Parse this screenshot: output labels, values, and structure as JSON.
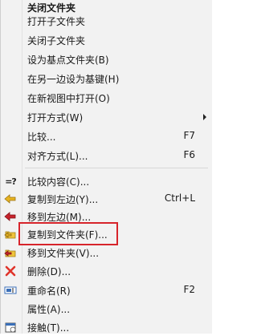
{
  "menu": {
    "items": [
      {
        "label": "关闭文件夹",
        "shortcut": "",
        "submenu": false,
        "bold": true,
        "icon": ""
      },
      {
        "label": "打开子文件夹",
        "shortcut": "",
        "submenu": false,
        "icon": ""
      },
      {
        "label": "关闭子文件夹",
        "shortcut": "",
        "submenu": false,
        "icon": ""
      },
      {
        "label": "设为基点文件夹(B)",
        "shortcut": "",
        "submenu": false,
        "icon": ""
      },
      {
        "label": "在另一边设为基键(H)",
        "shortcut": "",
        "submenu": false,
        "icon": ""
      },
      {
        "label": "在新视图中打开(O)",
        "shortcut": "",
        "submenu": false,
        "icon": ""
      },
      {
        "label": "打开方式(W)",
        "shortcut": "",
        "submenu": true,
        "icon": ""
      },
      {
        "label": "比较...",
        "shortcut": "F7",
        "submenu": false,
        "icon": ""
      },
      {
        "label": "对齐方式(L)...",
        "shortcut": "F6",
        "submenu": false,
        "icon": ""
      },
      {
        "label": "比较内容(C)...",
        "shortcut": "",
        "submenu": false,
        "icon": "equals-question-icon",
        "icon_text": "=?"
      },
      {
        "label": "复制到左边(Y)...",
        "shortcut": "Ctrl+L",
        "submenu": false,
        "icon": "copy-left-arrow-icon"
      },
      {
        "label": "移到左边(M)...",
        "shortcut": "",
        "submenu": false,
        "icon": "move-left-arrow-icon"
      },
      {
        "label": "复制到文件夹(F)...",
        "shortcut": "",
        "submenu": false,
        "icon": "copy-to-folder-icon"
      },
      {
        "label": "移到文件夹(V)...",
        "shortcut": "",
        "submenu": false,
        "icon": "move-to-folder-icon"
      },
      {
        "label": "删除(D)...",
        "shortcut": "",
        "submenu": false,
        "icon": "delete-x-icon"
      },
      {
        "label": "重命名(R)",
        "shortcut": "F2",
        "submenu": false,
        "icon": "rename-icon"
      },
      {
        "label": "属性(A)...",
        "shortcut": "",
        "submenu": false,
        "icon": ""
      },
      {
        "label": "接触(T)...",
        "shortcut": "",
        "submenu": false,
        "icon": "touch-calendar-icon"
      }
    ]
  },
  "colors": {
    "highlight_border": "#d7242b",
    "arrow_yellow": "#e7b321",
    "arrow_red": "#c8232c",
    "delete_red": "#e0342b"
  }
}
